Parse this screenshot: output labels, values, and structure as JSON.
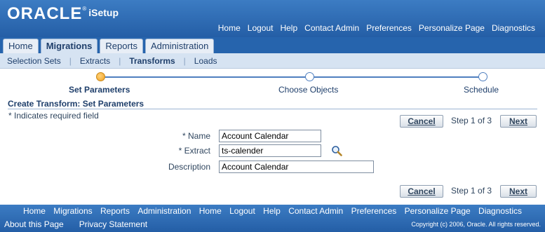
{
  "brand": {
    "logo_text": "ORACLE",
    "registered_mark": "®",
    "product": "iSetup"
  },
  "global_nav": [
    "Home",
    "Logout",
    "Help",
    "Contact Admin",
    "Preferences",
    "Personalize Page",
    "Diagnostics"
  ],
  "tabs": [
    {
      "label": "Home",
      "active": false
    },
    {
      "label": "Migrations",
      "active": true
    },
    {
      "label": "Reports",
      "active": false
    },
    {
      "label": "Administration",
      "active": false
    }
  ],
  "subnav": [
    {
      "label": "Selection Sets",
      "active": false
    },
    {
      "label": "Extracts",
      "active": false
    },
    {
      "label": "Transforms",
      "active": true
    },
    {
      "label": "Loads",
      "active": false
    }
  ],
  "train": {
    "stops": [
      {
        "label": "Set Parameters",
        "current": true
      },
      {
        "label": "Choose Objects",
        "current": false
      },
      {
        "label": "Schedule",
        "current": false
      }
    ]
  },
  "page": {
    "title": "Create Transform: Set Parameters",
    "required_note": "* Indicates required field",
    "cancel_label": "Cancel",
    "next_label": "Next",
    "step_text": "Step 1 of 3"
  },
  "form": {
    "name_label": "Name",
    "name_value": "Account Calendar",
    "extract_label": "Extract",
    "extract_value": "ts-calender",
    "description_label": "Description",
    "description_value": "Account Calendar",
    "required_marker": "*"
  },
  "footer": {
    "links": [
      "Home",
      "Migrations",
      "Reports",
      "Administration",
      "Home",
      "Logout",
      "Help",
      "Contact Admin",
      "Preferences",
      "Personalize Page",
      "Diagnostics"
    ],
    "about": "About this Page",
    "privacy": "Privacy Statement",
    "copyright": "Copyright (c) 2006, Oracle. All rights reserved."
  }
}
